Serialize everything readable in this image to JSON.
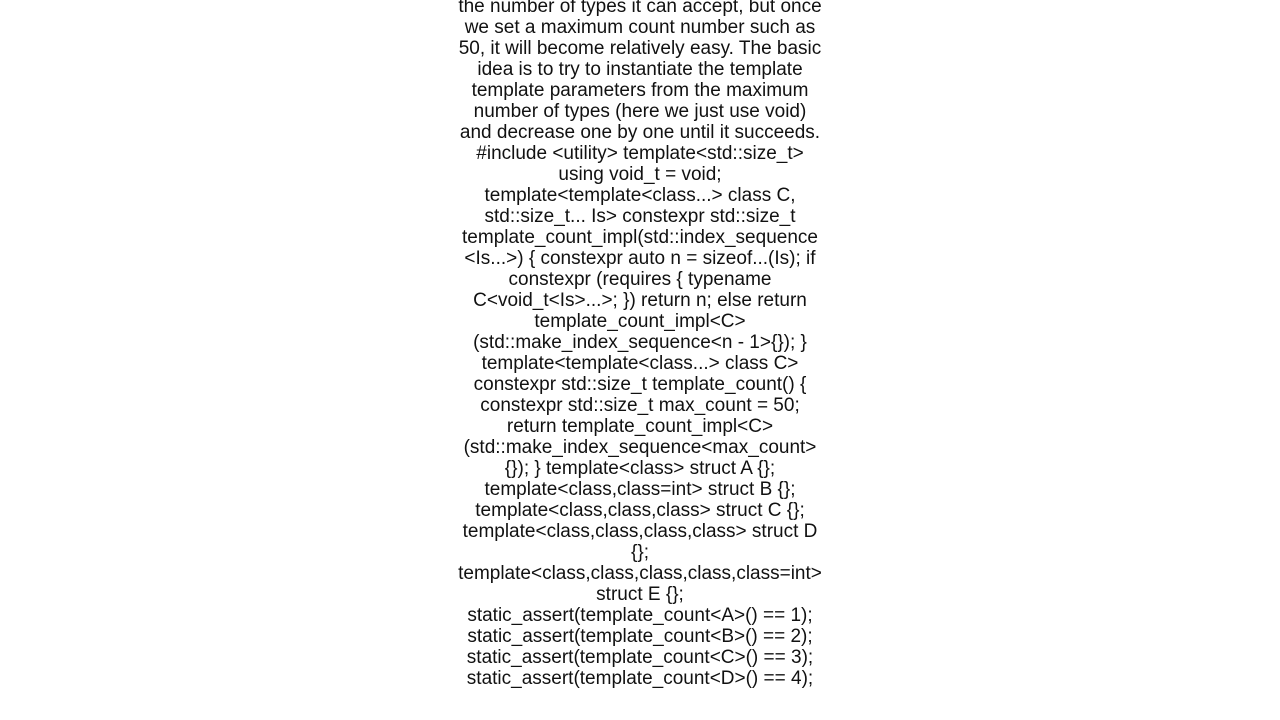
{
  "document": {
    "body_text": "the number of types it can accept, but once we set a maximum count number such as 50, it will become relatively easy. The basic idea is to try to instantiate the template template parameters from the maximum number of types (here we just use void) and decrease one by one until it succeeds. #include <utility> template<std::size_t> using void_t = void;  template<template<class...> class C, std::size_t... Is> constexpr std::size_t template_count_impl(std::index_sequence<Is...>) {   constexpr auto n = sizeof...(Is);   if constexpr (requires { typename C<void_t<Is>...>; })     return n;   else     return template_count_impl<C>(std::make_index_sequence<n - 1>{}); }  template<template<class...> class C> constexpr std::size_t template_count() {   constexpr std::size_t max_count = 50;   return template_count_impl<C>(std::make_index_sequence<max_count>{}); }  template<class> struct A {}; template<class,class=int> struct B {}; template<class,class,class> struct C {}; template<class,class,class,class> struct D {}; template<class,class,class,class,class=int> struct E {};  static_assert(template_count<A>() == 1); static_assert(template_count<B>() == 2); static_assert(template_count<C>() == 3); static_assert(template_count<D>() == 4);"
  }
}
